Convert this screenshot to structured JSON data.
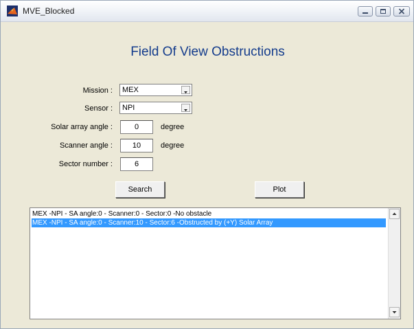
{
  "window": {
    "title": "MVE_Blocked"
  },
  "heading": "Field Of View Obstructions",
  "form": {
    "mission": {
      "label": "Mission :",
      "value": "MEX"
    },
    "sensor": {
      "label": "Sensor :",
      "value": "NPI"
    },
    "solar_array_angle": {
      "label": "Solar array angle :",
      "value": "0",
      "unit": "degree"
    },
    "scanner_angle": {
      "label": "Scanner angle :",
      "value": "10",
      "unit": "degree"
    },
    "sector_number": {
      "label": "Sector number :",
      "value": "6"
    }
  },
  "buttons": {
    "search": "Search",
    "plot": "Plot"
  },
  "results": {
    "items": [
      "MEX -NPI - SA angle:0 - Scanner:0 - Sector:0 -No obstacle",
      "MEX -NPI - SA angle:0 - Scanner:10 - Sector:6 -Obstructed by (+Y) Solar Array"
    ],
    "selected_index": 1
  },
  "icons": {
    "app": "matlab-app-icon",
    "minimize": "minimize-icon",
    "maximize": "maximize-icon",
    "close": "close-icon",
    "dropdown": "chevron-down-icon",
    "scroll_up": "arrow-up-icon",
    "scroll_down": "arrow-down-icon"
  },
  "colors": {
    "heading": "#143c8c",
    "selection": "#3399ff",
    "panel": "#ece9d8"
  }
}
